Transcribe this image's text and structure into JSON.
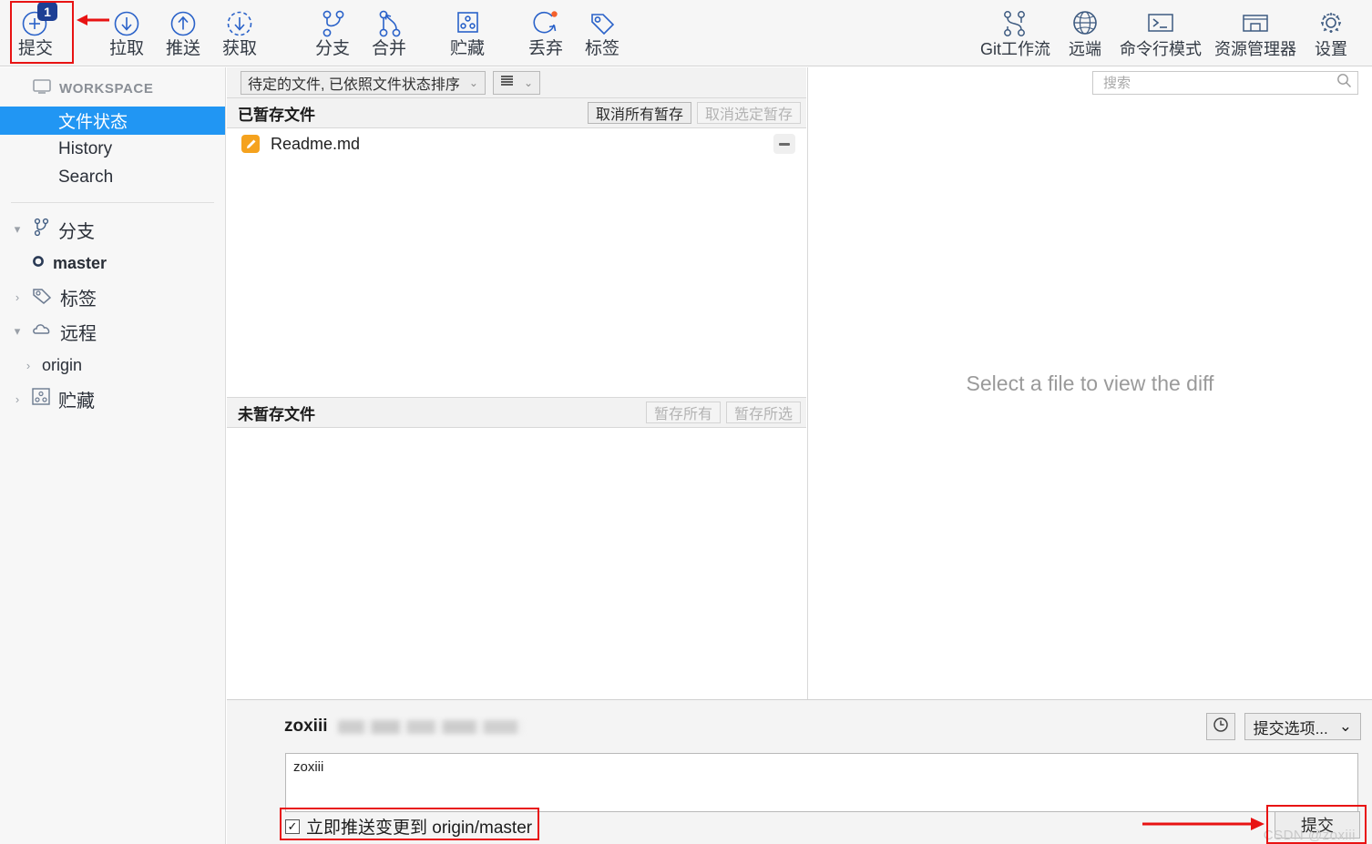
{
  "toolbar": {
    "left_items": [
      {
        "label": "提交",
        "icon": "commit-plus-icon",
        "badge": "1",
        "highlighted": true
      },
      {
        "label": "拉取",
        "icon": "pull-down-arrow-icon"
      },
      {
        "label": "推送",
        "icon": "push-up-arrow-icon"
      },
      {
        "label": "获取",
        "icon": "fetch-dashed-arrow-icon"
      },
      {
        "label": "分支",
        "icon": "branch-icon"
      },
      {
        "label": "合并",
        "icon": "merge-icon"
      },
      {
        "label": "贮藏",
        "icon": "stash-icon"
      },
      {
        "label": "丢弃",
        "icon": "discard-refresh-icon"
      },
      {
        "label": "标签",
        "icon": "tag-icon"
      }
    ],
    "right_items": [
      {
        "label": "Git工作流",
        "icon": "git-flow-icon"
      },
      {
        "label": "远端",
        "icon": "globe-remote-icon"
      },
      {
        "label": "命令行模式",
        "icon": "terminal-icon"
      },
      {
        "label": "资源管理器",
        "icon": "explorer-folder-icon"
      },
      {
        "label": "设置",
        "icon": "gear-icon"
      }
    ]
  },
  "sidebar": {
    "workspace_label": "WORKSPACE",
    "items": [
      {
        "label": "文件状态",
        "selected": true
      },
      {
        "label": "History",
        "selected": false
      },
      {
        "label": "Search",
        "selected": false
      }
    ],
    "groups": [
      {
        "label": "分支",
        "icon": "branch-icon",
        "expanded": true,
        "chevron": "▾",
        "children": [
          {
            "label": "master",
            "icon": "current-branch-dot-icon",
            "bold": true
          }
        ]
      },
      {
        "label": "标签",
        "icon": "tag-icon",
        "expanded": false,
        "chevron": "›",
        "children": []
      },
      {
        "label": "远程",
        "icon": "cloud-icon",
        "expanded": true,
        "chevron": "▾",
        "children": [
          {
            "label": "origin",
            "icon": "chevron-right-icon",
            "bold": false
          }
        ]
      },
      {
        "label": "贮藏",
        "icon": "stash-icon",
        "expanded": false,
        "chevron": "›",
        "children": []
      }
    ]
  },
  "filter_bar": {
    "sort_dropdown": "待定的文件, 已依照文件状态排序",
    "view_dropdown_icon": "list-view-icon"
  },
  "search": {
    "placeholder": "搜索",
    "value": "",
    "icon": "search-icon"
  },
  "staged": {
    "title": "已暂存文件",
    "buttons": [
      {
        "label": "取消所有暂存",
        "disabled": false
      },
      {
        "label": "取消选定暂存",
        "disabled": true
      }
    ],
    "files": [
      {
        "name": "Readme.md",
        "status_icon": "modified-file-icon",
        "status_color": "#f5a21e",
        "action_icon": "unstage-minus-icon"
      }
    ]
  },
  "unstaged": {
    "title": "未暂存文件",
    "buttons": [
      {
        "label": "暂存所有",
        "disabled": true
      },
      {
        "label": "暂存所选",
        "disabled": true
      }
    ],
    "files": []
  },
  "diff": {
    "empty_message": "Select a file to view the diff"
  },
  "commit_panel": {
    "author": "zoxiii",
    "author_email_redacted": true,
    "history_button_icon": "clock-history-icon",
    "options_button": "提交选项...",
    "message_value": "zoxiii",
    "message_placeholder": "",
    "push_checkbox": {
      "label": "立即推送变更到 origin/master",
      "checked": true,
      "highlighted": true
    },
    "commit_button": {
      "label": "提交",
      "highlighted": true
    }
  },
  "watermark": "CSDN @zoxiii",
  "colors": {
    "accent_blue": "#2196f3",
    "icon_blue": "#2a62c9",
    "badge_blue": "#1d3f94",
    "highlight_red": "#e81313",
    "modified_orange": "#f5a21e",
    "toolbar_bg": "#f6f6f6",
    "sidebar_bg": "#f7f7f7",
    "panel_bg": "#f2f2f2"
  }
}
